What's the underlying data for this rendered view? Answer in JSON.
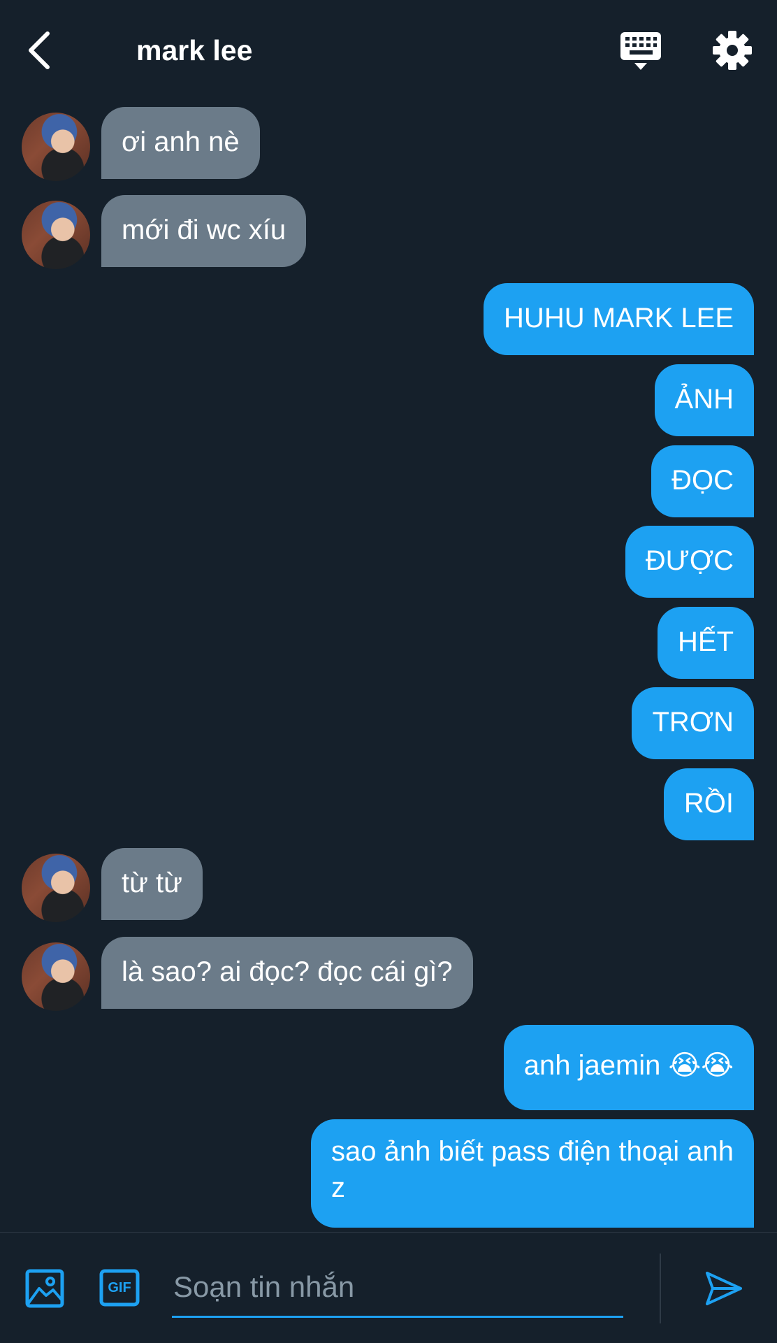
{
  "header": {
    "title": "mark lee"
  },
  "messages": [
    {
      "side": "in",
      "text": "ơi anh nè"
    },
    {
      "side": "in",
      "text": "mới đi wc xíu"
    },
    {
      "side": "out",
      "text": "HUHU MARK LEE"
    },
    {
      "side": "out",
      "text": "ẢNH"
    },
    {
      "side": "out",
      "text": "ĐỌC"
    },
    {
      "side": "out",
      "text": "ĐƯỢC"
    },
    {
      "side": "out",
      "text": "HẾT"
    },
    {
      "side": "out",
      "text": "TRƠN"
    },
    {
      "side": "out",
      "text": "RỒI"
    },
    {
      "side": "in",
      "text": "từ từ"
    },
    {
      "side": "in",
      "text": "là sao? ai đọc? đọc cái gì?"
    },
    {
      "side": "out",
      "text": "anh jaemin 😭😭"
    },
    {
      "side": "out",
      "text": "sao ảnh biết pass điện thoại anh",
      "text2": "z"
    }
  ],
  "composer": {
    "placeholder": "Soạn tin nhắn",
    "gif_label": "GIF"
  },
  "colors": {
    "background": "#15202b",
    "incoming_bubble": "#6b7b89",
    "outgoing_bubble": "#1da1f2",
    "accent": "#1da1f2"
  },
  "icons": [
    "back-arrow-icon",
    "keyboard-icon",
    "gear-icon",
    "image-icon",
    "gif-icon",
    "send-icon"
  ]
}
